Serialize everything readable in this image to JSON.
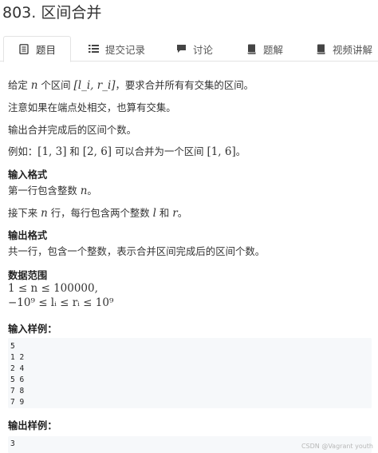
{
  "problem": {
    "title": "803. 区间合并"
  },
  "tabs": [
    {
      "label": "题目",
      "icon": "document-icon",
      "active": true
    },
    {
      "label": "提交记录",
      "icon": "list-icon",
      "active": false
    },
    {
      "label": "讨论",
      "icon": "chat-icon",
      "active": false
    },
    {
      "label": "题解",
      "icon": "book-icon",
      "active": false
    },
    {
      "label": "视频讲解",
      "icon": "book-icon",
      "active": false
    }
  ],
  "statement": {
    "p1_pre": "给定 ",
    "p1_n": "n",
    "p1_mid": " 个区间 ",
    "p1_interval": "[l_i, r_i]",
    "p1_post": "，要求合并所有有交集的区间。",
    "p2": "注意如果在端点处相交，也算有交集。",
    "p3": "输出合并完成后的区间个数。",
    "p4_pre": "例如：",
    "p4_a": "[1, 3]",
    "p4_and": " 和 ",
    "p4_b": "[2, 6]",
    "p4_mid": " 可以合并为一个区间 ",
    "p4_c": "[1, 6]",
    "p4_post": "。"
  },
  "input_format": {
    "heading": "输入格式",
    "line1_pre": "第一行包含整数 ",
    "line1_n": "n",
    "line1_post": "。",
    "line2_pre": "接下来 ",
    "line2_n": "n",
    "line2_mid": " 行，每行包含两个整数 ",
    "line2_l": "l",
    "line2_and": " 和 ",
    "line2_r": "r",
    "line2_post": "。"
  },
  "output_format": {
    "heading": "输出格式",
    "text": "共一行，包含一个整数，表示合并区间完成后的区间个数。"
  },
  "range": {
    "heading": "数据范围",
    "c1": "1 ≤ n ≤ 100000,",
    "c2": "−10⁹ ≤ lᵢ ≤ rᵢ ≤ 10⁹"
  },
  "sample_input": {
    "heading": "输入样例：",
    "lines": [
      "5",
      "1 2",
      "2 4",
      "5 6",
      "7 8",
      "7 9"
    ]
  },
  "sample_output": {
    "heading": "输出样例：",
    "lines": [
      "3"
    ]
  },
  "watermark": "CSDN @Vagrant youth"
}
